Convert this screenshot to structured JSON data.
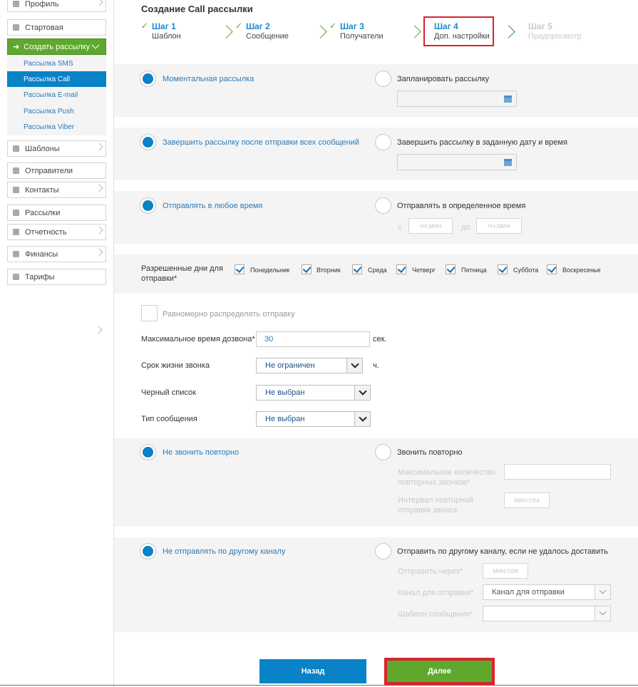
{
  "sidebar": {
    "profile": "Профиль",
    "start": "Стартовая",
    "create": "Создать рассылку",
    "sub": [
      "Рассылка SMS",
      "Рассылка Call",
      "Рассылка E-mail",
      "Рассылка Push",
      "Рассылка Viber"
    ],
    "templates": "Шаблоны",
    "senders": "Отправители",
    "contacts": "Контакты",
    "mailings": "Рассылки",
    "reports": "Отчетность",
    "finance": "Финансы",
    "tariffs": "Тарифы"
  },
  "header": {
    "title": "Создание Call рассылки"
  },
  "steps": [
    {
      "title": "Шаг 1",
      "sub": "Шаблон"
    },
    {
      "title": "Шаг 2",
      "sub": "Сообщение"
    },
    {
      "title": "Шаг 3",
      "sub": "Получатели"
    },
    {
      "title": "Шаг 4",
      "sub": "Доп. настройки"
    },
    {
      "title": "Шаг 5",
      "sub": "Предпросмотр"
    }
  ],
  "send_time": {
    "instant": "Моментальная рассылка",
    "scheduled": "Запланировать рассылку"
  },
  "finish": {
    "after_all": "Завершить рассылку после отправки всех сообщений",
    "at_date": "Завершить рассылку в заданную дату и время"
  },
  "window": {
    "any": "Отправлять в любое время",
    "specific": "Отправлять в определенное время",
    "from": "с",
    "to": "до",
    "placeholder": "чч:мин"
  },
  "days": {
    "label": "Разрешенные дни для отправки*",
    "items": [
      "Понедельник",
      "Вторник",
      "Среда",
      "Четверг",
      "Пятница",
      "Суббота",
      "Воскресенье"
    ]
  },
  "even": "Равномерно распределять отправку",
  "max_dial": {
    "label": "Максимальное время дозвона*",
    "value": "30",
    "unit": "сек."
  },
  "ttl": {
    "label": "Срок жизни звонка",
    "value": "Не ограничен",
    "unit": "ч."
  },
  "blacklist": {
    "label": "Черный список",
    "value": "Не выбран"
  },
  "msg_type": {
    "label": "Тип сообщения",
    "value": "Не выбран"
  },
  "redial": {
    "no": "Не звонить повторно",
    "yes": "Звонить повторно",
    "max_count": "Максимальное количество повторных звонков*",
    "interval": "Интервал повторной отправки звонка",
    "interval_placeholder": "мин:сек"
  },
  "fallback": {
    "no": "Не отправлять по другому каналу",
    "yes": "Отправить по другому каналу, если не удалось доставить",
    "via": "Отправить через*",
    "via_placeholder": "мин:сек",
    "channel": "Канал для отправки*",
    "channel_value": "Канал для отправки",
    "template": "Шаблон сообщения*"
  },
  "buttons": {
    "back": "Назад",
    "next": "Далее"
  }
}
